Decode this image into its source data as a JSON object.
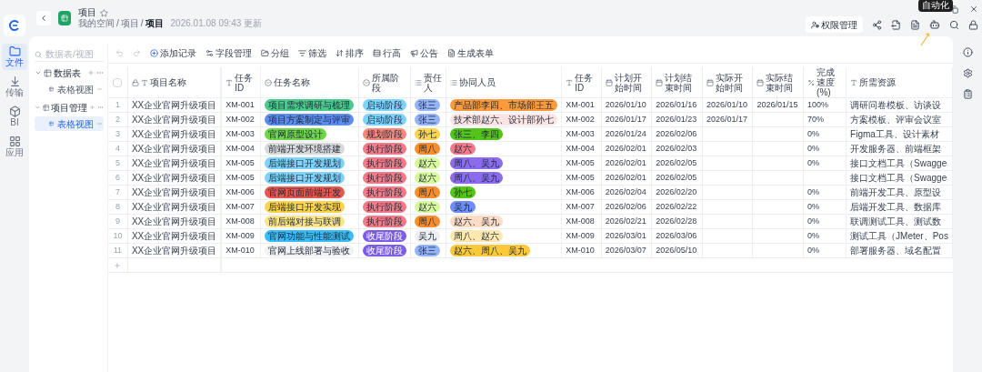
{
  "rail": {
    "items": [
      {
        "label": "文件",
        "selected": true,
        "kind": "folder"
      },
      {
        "label": "传输",
        "selected": false,
        "kind": "transfer"
      },
      {
        "label": "BI",
        "selected": false,
        "kind": "bi"
      },
      {
        "label": "应用",
        "selected": false,
        "kind": "apps"
      }
    ]
  },
  "header": {
    "title": "项目",
    "starred": false,
    "breadcrumb": [
      "我的空间",
      "项目",
      "项目"
    ],
    "separator": "/",
    "updated": "2026.01.08 09:43 更新",
    "permission_button": "权限管理",
    "tooltip": "自动化"
  },
  "tree": {
    "search_placeholder": "数据表/视图",
    "groups": [
      {
        "label": "数据表",
        "expanded": true,
        "children": [
          {
            "label": "表格视图",
            "selected": false
          }
        ]
      },
      {
        "label": "项目管理",
        "expanded": true,
        "children": [
          {
            "label": "表格视图",
            "selected": true
          }
        ]
      }
    ]
  },
  "toolbar": {
    "items": [
      {
        "label": "添加记录",
        "kind": "add"
      },
      {
        "label": "字段管理",
        "kind": "fields"
      },
      {
        "label": "分组",
        "kind": "group"
      },
      {
        "label": "筛选",
        "kind": "filter"
      },
      {
        "label": "排序",
        "kind": "sort"
      },
      {
        "label": "行高",
        "kind": "height"
      },
      {
        "label": "公告",
        "kind": "notice"
      },
      {
        "label": "生成表单",
        "kind": "form"
      }
    ]
  },
  "table": {
    "select_all": {
      "checked": false
    },
    "columns": [
      {
        "label": "项目名称",
        "kind": "primary"
      },
      {
        "label": "任务ID",
        "kind": "text"
      },
      {
        "label": "任务名称",
        "kind": "select"
      },
      {
        "label": "所属阶段",
        "kind": "select"
      },
      {
        "label": "责任人",
        "kind": "list"
      },
      {
        "label": "协同人员",
        "kind": "list"
      },
      {
        "label": "任务ID",
        "kind": "text"
      },
      {
        "label": "计划开始时间",
        "kind": "date"
      },
      {
        "label": "计划结束时间",
        "kind": "date"
      },
      {
        "label": "实际开始时间",
        "kind": "date"
      },
      {
        "label": "实际结束时间",
        "kind": "date"
      },
      {
        "label": "完成速度(%)",
        "kind": "number"
      },
      {
        "label": "所需资源",
        "kind": "text"
      }
    ],
    "rows": [
      {
        "index": "1",
        "project": "XX企业官网升级项目",
        "task_id": "XM-001",
        "task_name": {
          "text": "项目需求调研与梳理",
          "color": "#4cc98c"
        },
        "stage": {
          "text": "启动阶段",
          "color": "#7dd3fc"
        },
        "owner": {
          "text": "张三",
          "color": "#93b4fa"
        },
        "collaborators": {
          "text": "产品部李四、市场部王五",
          "color": "#fb9a3c"
        },
        "task_id_2": "XM-001",
        "plan_start": "2026/01/10",
        "plan_end": "2026/01/16",
        "actual_start": "2026/01/10",
        "actual_end": "2026/01/15",
        "progress": "100%",
        "resources": "调研问卷模板、访谈设"
      },
      {
        "index": "2",
        "project": "XX企业官网升级项目",
        "task_id": "XM-002",
        "task_name": {
          "text": "项目方案制定与评审",
          "color": "#5b8def"
        },
        "stage": {
          "text": "启动阶段",
          "color": "#7dd3fc"
        },
        "owner": {
          "text": "张三",
          "color": "#93b4fa"
        },
        "collaborators": {
          "text": "技术部赵六、设计部孙七",
          "color": "#fde4e4"
        },
        "task_id_2": "XM-002",
        "plan_start": "2026/01/17",
        "plan_end": "2026/01/23",
        "actual_start": "2026/01/17",
        "progress": "70%",
        "resources": "方案模板、评审会议室"
      },
      {
        "index": "3",
        "project": "XX企业官网升级项目",
        "task_id": "XM-003",
        "task_name": {
          "text": "官网原型设计",
          "color": "#6fd44a"
        },
        "stage": {
          "text": "规划阶段",
          "color": "#f8877a"
        },
        "owner": {
          "text": "孙七",
          "color": "#fcd34d"
        },
        "collaborators": {
          "text": "张三、李四",
          "color": "#52c41a"
        },
        "task_id_2": "XM-003",
        "plan_start": "2026/01/24",
        "plan_end": "2026/02/06",
        "progress": "0%",
        "resources": "Figma工具、设计素材"
      },
      {
        "index": "4",
        "project": "XX企业官网升级项目",
        "task_id": "XM-004",
        "task_name": {
          "text": "前端开发环境搭建",
          "color": "#d9d9d9"
        },
        "stage": {
          "text": "执行阶段",
          "color": "#f47a8a"
        },
        "owner": {
          "text": "周八",
          "color": "#fb8c2c"
        },
        "collaborators": {
          "text": "赵六",
          "color": "#f47a8a"
        },
        "task_id_2": "XM-004",
        "plan_start": "2026/02/01",
        "plan_end": "2026/02/03",
        "progress": "0%",
        "resources": "开发服务器、前端框架"
      },
      {
        "index": "5",
        "project": "XX企业官网升级项目",
        "task_id": "XM-005",
        "task_name": {
          "text": "后端接口开发规划",
          "color": "#7dd3fc"
        },
        "stage": {
          "text": "执行阶段",
          "color": "#f47a8a"
        },
        "owner": {
          "text": "赵六",
          "color": "#d9f99d"
        },
        "collaborators": {
          "text": "周八、吴九",
          "color": "#8b6cf0"
        },
        "task_id_2": "XM-005",
        "plan_start": "2026/02/01",
        "plan_end": "2026/02/05",
        "progress": "0%",
        "resources": "接口文档工具（Swagge"
      },
      {
        "index": "6",
        "project": "XX企业官网升级项目",
        "task_id": "XM-005",
        "task_name": {
          "text": "后端接口开发规划",
          "color": "#7dd3fc"
        },
        "stage": {
          "text": "执行阶段",
          "color": "#f47a8a"
        },
        "owner": {
          "text": "赵六",
          "color": "#d9f99d"
        },
        "collaborators": {
          "text": "周八、吴九",
          "color": "#8b6cf0"
        },
        "task_id_2": "XM-005",
        "plan_start": "2026/02/01",
        "plan_end": "2026/02/05",
        "resources": "接口文档工具（Swagge"
      },
      {
        "index": "7",
        "project": "XX企业官网升级项目",
        "task_id": "XM-006",
        "task_name": {
          "text": "官网页面前端开发",
          "color": "#e5584f"
        },
        "stage": {
          "text": "执行阶段",
          "color": "#f47a8a"
        },
        "owner": {
          "text": "周八",
          "color": "#fb8c2c"
        },
        "collaborators": {
          "text": "孙七",
          "color": "#52c41a"
        },
        "task_id_2": "XM-006",
        "plan_start": "2026/02/04",
        "plan_end": "2026/02/20",
        "progress": "0%",
        "resources": "前端开发工具、原型设"
      },
      {
        "index": "8",
        "project": "XX企业官网升级项目",
        "task_id": "XM-007",
        "task_name": {
          "text": "后端接口开发实现",
          "color": "#fcd34d"
        },
        "stage": {
          "text": "执行阶段",
          "color": "#f47a8a"
        },
        "owner": {
          "text": "赵六",
          "color": "#d9f99d"
        },
        "collaborators": {
          "text": "吴九",
          "color": "#6d8df7"
        },
        "task_id_2": "XM-007",
        "plan_start": "2026/02/06",
        "plan_end": "2026/02/22",
        "progress": "0%",
        "resources": "后端开发工具、数据库"
      },
      {
        "index": "9",
        "project": "XX企业官网升级项目",
        "task_id": "XM-008",
        "task_name": {
          "text": "前后端对接与联调",
          "color": "#fde68a"
        },
        "stage": {
          "text": "执行阶段",
          "color": "#f47a8a"
        },
        "owner": {
          "text": "周八",
          "color": "#fb8c2c"
        },
        "collaborators": {
          "text": "赵六、吴九",
          "color": "#fcdcc4"
        },
        "task_id_2": "XM-008",
        "plan_start": "2026/02/21",
        "plan_end": "2026/02/28",
        "progress": "0%",
        "resources": "联调测试工具、测试数"
      },
      {
        "index": "10",
        "project": "XX企业官网升级项目",
        "task_id": "XM-009",
        "task_name": {
          "text": "官网功能与性能测试",
          "color": "#38bdf8"
        },
        "stage": {
          "text": "收尾阶段",
          "color": "#7c5ce6"
        },
        "owner": {
          "text": "吴九",
          "color": "#eeeff1"
        },
        "collaborators": {
          "text": "周八、赵六",
          "color": "#fde9b0"
        },
        "task_id_2": "XM-009",
        "plan_start": "2026/03/01",
        "plan_end": "2026/03/06",
        "progress": "0%",
        "resources": "测试工具（JMeter、Pos"
      },
      {
        "index": "11",
        "project": "XX企业官网升级项目",
        "task_id": "XM-010",
        "task_name": {
          "text": "官网上线部署与验收",
          "color": "#f1f2f4"
        },
        "stage": {
          "text": "收尾阶段",
          "color": "#7c5ce6"
        },
        "owner": {
          "text": "张三",
          "color": "#93b4fa"
        },
        "collaborators": {
          "text": "赵六、周八、吴九",
          "color": "#fcc93a"
        },
        "task_id_2": "XM-010",
        "plan_start": "2026/03/07",
        "plan_end": "2026/05/10",
        "progress": "0%",
        "resources": "部署服务器、域名配置"
      }
    ]
  }
}
